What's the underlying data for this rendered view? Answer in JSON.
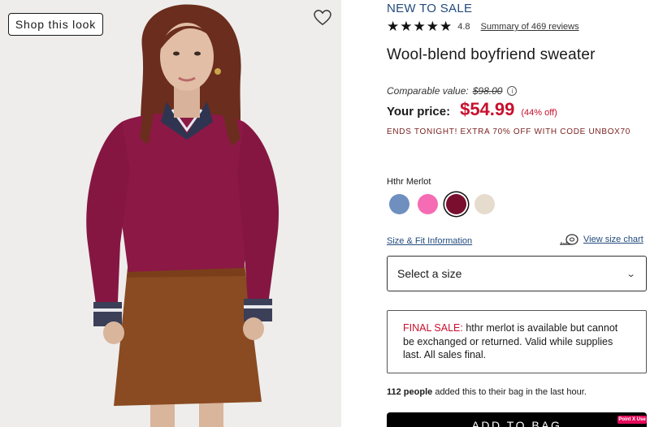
{
  "image": {
    "shop_look_label": "Shop this look",
    "favorite_icon": "heart-outline-icon"
  },
  "product": {
    "tag": "NEW TO SALE",
    "rating": {
      "stars": 5,
      "value": "4.8",
      "reviews_link": "Summary of 469 reviews"
    },
    "title": "Wool-blend boyfriend sweater"
  },
  "pricing": {
    "comparable_label": "Comparable value:",
    "comparable_price": "$98.00",
    "info_icon": "info-circle-icon",
    "your_price_label": "Your price:",
    "your_price": "$54.99",
    "discount": "(44% off)",
    "promo": "ENDS TONIGHT! EXTRA 70% OFF WITH CODE UNBOX70"
  },
  "color": {
    "selected_name": "Hthr Merlot",
    "swatches": [
      {
        "color": "#6f8fbe",
        "selected": false
      },
      {
        "color": "#f56bb4",
        "selected": false
      },
      {
        "color": "#7a0e2e",
        "selected": true
      },
      {
        "color": "#e6dccd",
        "selected": false
      }
    ]
  },
  "size": {
    "fit_link": "Size & Fit Information",
    "size_chart_icon": "measuring-tape-icon",
    "size_chart_link": "View size chart",
    "select_placeholder": "Select a size",
    "chevron_icon": "chevron-down-icon"
  },
  "notice": {
    "final_sale_label": "FINAL SALE:",
    "final_sale_text": " hthr merlot is available but cannot be exchanged or returned. Valid while supplies last. All sales final."
  },
  "social_proof": {
    "count": "112 people",
    "text": " added this to their bag in the last hour."
  },
  "cta": {
    "add_to_bag": "ADD TO BAG"
  },
  "extension_badge": "Point X Use",
  "colors": {
    "sale_red": "#c8102e",
    "link_blue": "#234b7d",
    "promo_maroon": "#7a1f1f"
  }
}
